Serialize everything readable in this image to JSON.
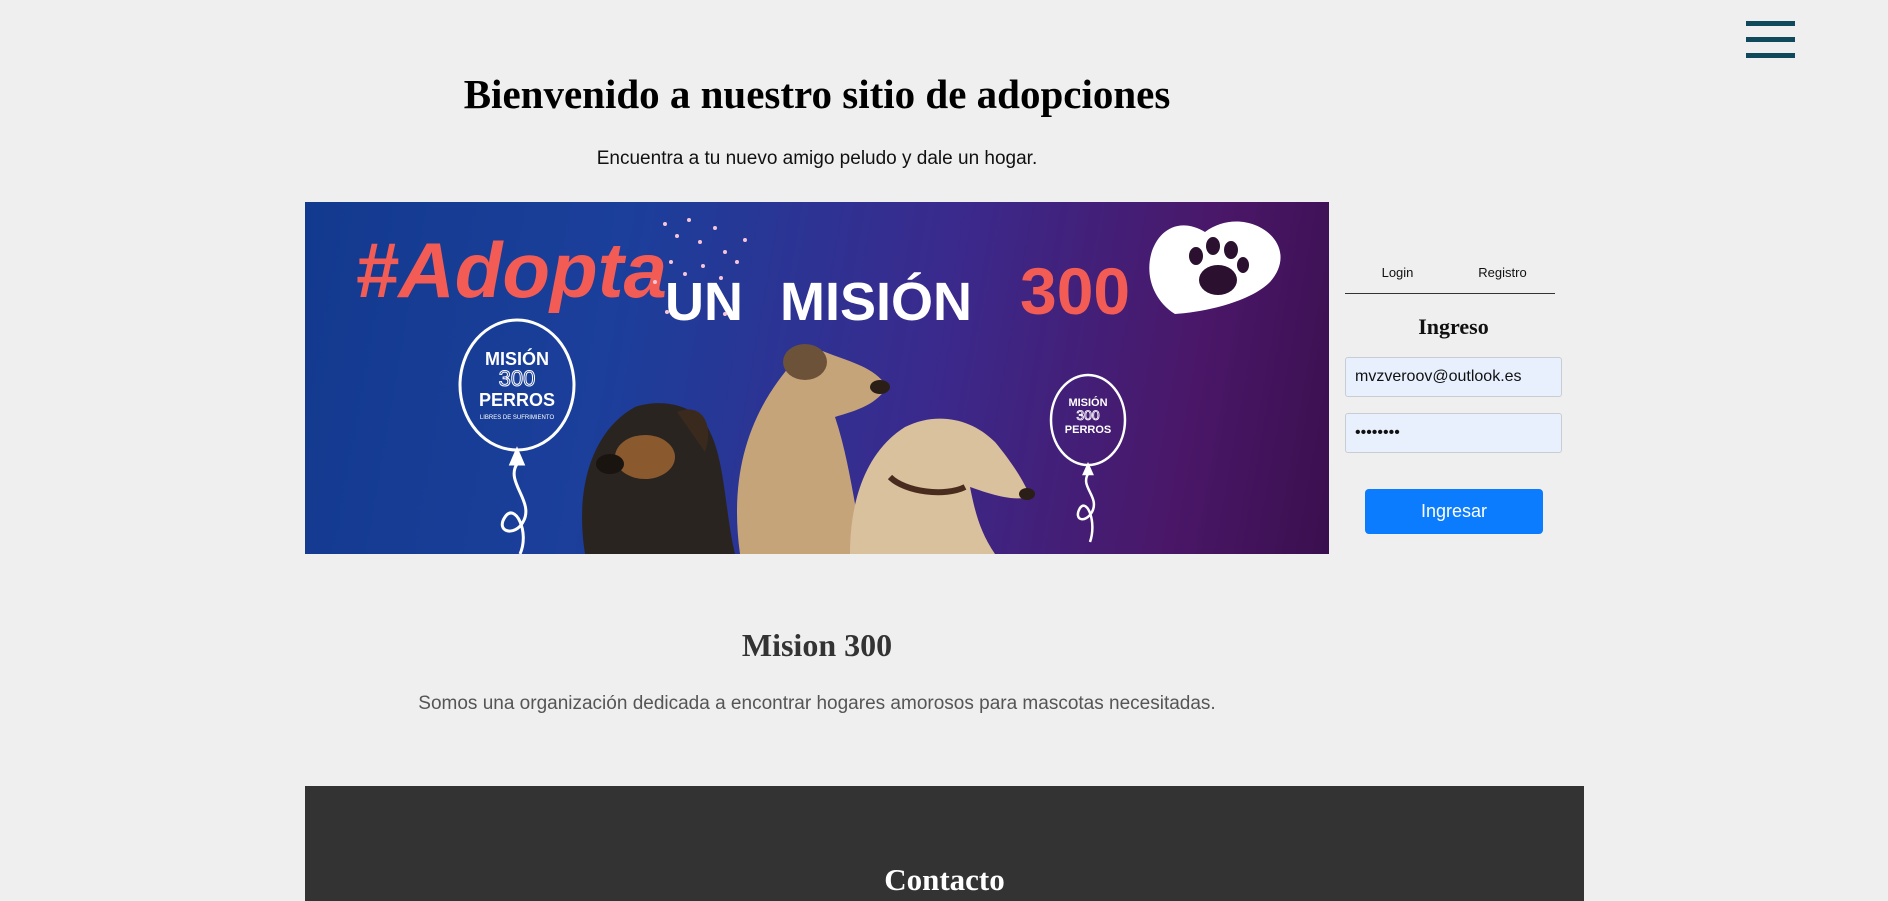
{
  "menu": {
    "icon": "hamburger-menu-icon"
  },
  "hero": {
    "title": "Bienvenido a nuestro sitio de adopciones",
    "subtitle": "Encuentra a tu nuevo amigo peludo y dale un hogar."
  },
  "banner": {
    "hashtag": "#Adopta",
    "un": "UN",
    "mision": "MISIÓN",
    "number": "300",
    "balloon_line1": "MISIÓN",
    "balloon_line2": "300",
    "balloon_line3": "PERROS",
    "balloon_line4": "LIBRES DE SUFRIMIENTO"
  },
  "auth": {
    "tabs": [
      "Login",
      "Registro"
    ],
    "heading": "Ingreso",
    "email_value": "mvzveroov@outlook.es",
    "password_value": "••••••••",
    "submit_label": "Ingresar"
  },
  "about": {
    "title": "Mision 300",
    "text": "Somos una organización dedicada a encontrar hogares amorosos para mascotas necesitadas."
  },
  "contact": {
    "title": "Contacto"
  },
  "colors": {
    "background": "#efefef",
    "menu": "#0e4a5c",
    "button": "#0a7cfd",
    "contact_bg": "#333333",
    "banner_accent": "#f25c54"
  }
}
